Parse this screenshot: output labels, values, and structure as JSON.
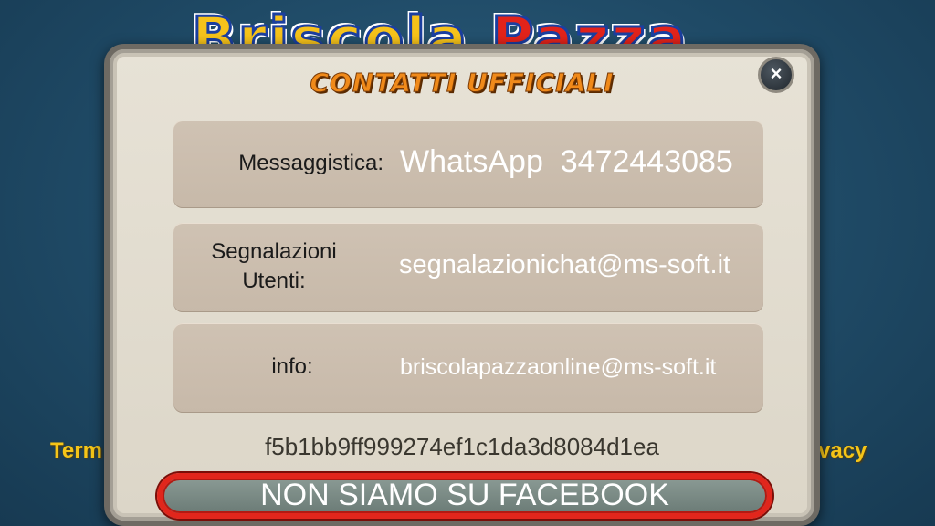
{
  "background": {
    "logo_part1": "Briscola ",
    "logo_part2": "Pazza",
    "terms_link": "Term",
    "privacy_link": "rivacy"
  },
  "modal": {
    "title": "CONTATTI UFFICIALI",
    "close_icon": "×",
    "rows": [
      {
        "label": "Messaggistica:",
        "value": "WhatsApp  3472443085"
      },
      {
        "label": "Segnalazioni Utenti:",
        "value": "segnalazionichat@ms-soft.it"
      },
      {
        "label": "info:",
        "value": "briscolapazzaonline@ms-soft.it"
      }
    ],
    "hash": "f5b1bb9ff999274ef1c1da3d8084d1ea",
    "facebook_button": "NON SIAMO SU FACEBOOK"
  },
  "colors": {
    "title_orange": "#f08a1a",
    "button_border_red": "#e1261c",
    "link_yellow": "#f5c518"
  }
}
